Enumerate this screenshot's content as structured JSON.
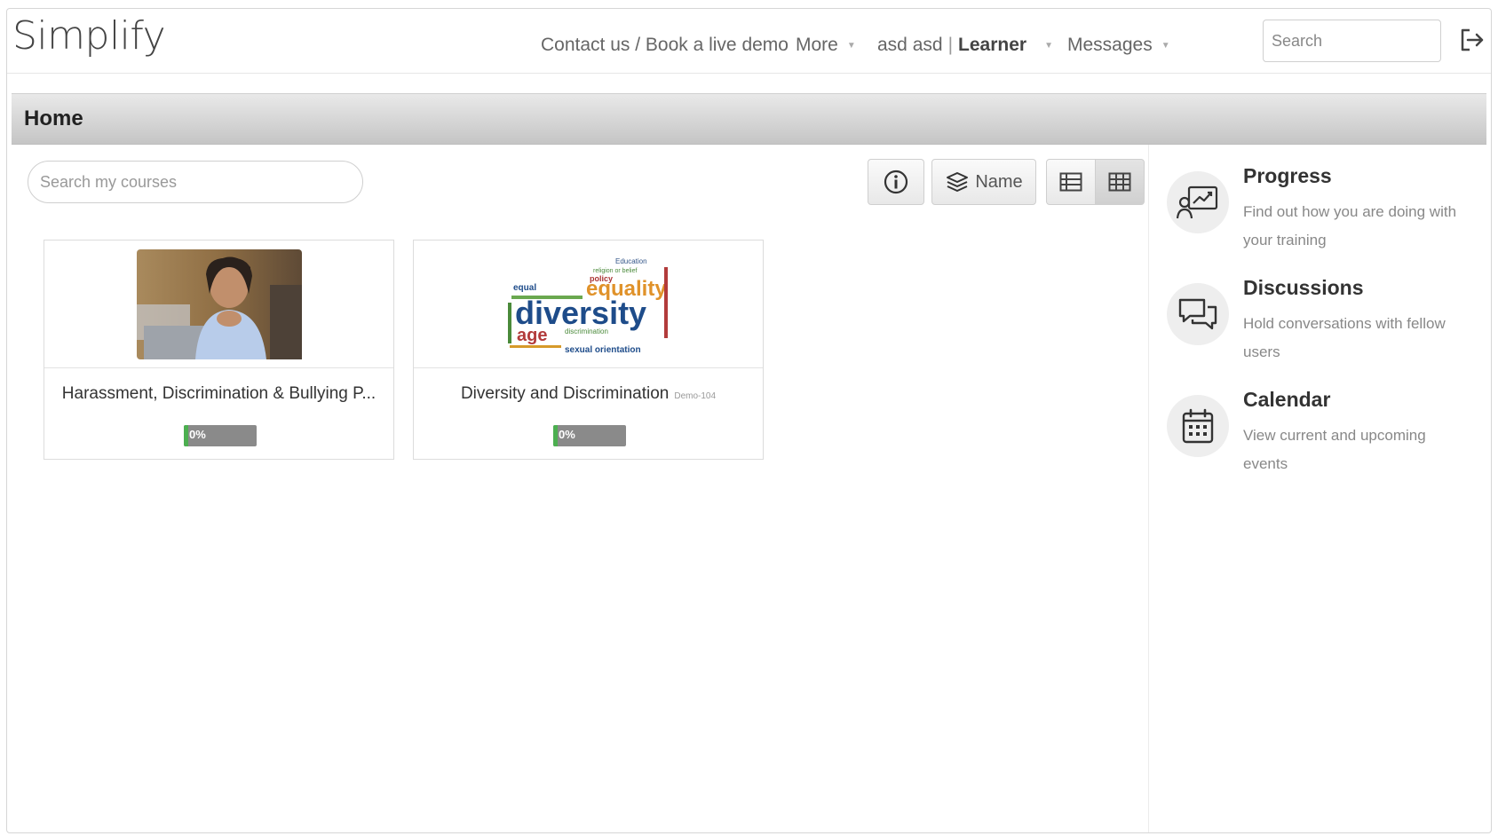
{
  "header": {
    "logo": "Simplify",
    "contact_label": "Contact us / Book a live demo",
    "more_label": "More",
    "user_name": "asd asd",
    "user_role": "Learner",
    "messages_label": "Messages",
    "search_placeholder": "Search"
  },
  "page": {
    "title": "Home"
  },
  "main": {
    "search_placeholder": "Search my courses",
    "sort_label": "Name",
    "courses": [
      {
        "title": "Harassment, Discrimination & Bullying P...",
        "code": "",
        "progress_label": "0%",
        "progress": 0
      },
      {
        "title": "Diversity and Discrimination",
        "code": "Demo-104",
        "progress_label": "0%",
        "progress": 0
      }
    ],
    "thumb_words": {
      "big": "diversity",
      "mid": "equality",
      "age": "age",
      "small1": "Education",
      "small2": "religion or belief",
      "small3": "policy",
      "small4": "equal",
      "small5": "sexual orientation",
      "small6": "discrimination"
    }
  },
  "sidebar": {
    "items": [
      {
        "title": "Progress",
        "desc": "Find out how you are doing with your training",
        "icon": "progress-chart-icon"
      },
      {
        "title": "Discussions",
        "desc": "Hold conversations with fellow users",
        "icon": "chat-bubbles-icon"
      },
      {
        "title": "Calendar",
        "desc": "View current and upcoming events",
        "icon": "calendar-icon"
      }
    ]
  },
  "colors": {
    "progress_fill": "#4caf50",
    "progress_track": "#8a8a8a",
    "homebar": "#d4d4d4"
  }
}
